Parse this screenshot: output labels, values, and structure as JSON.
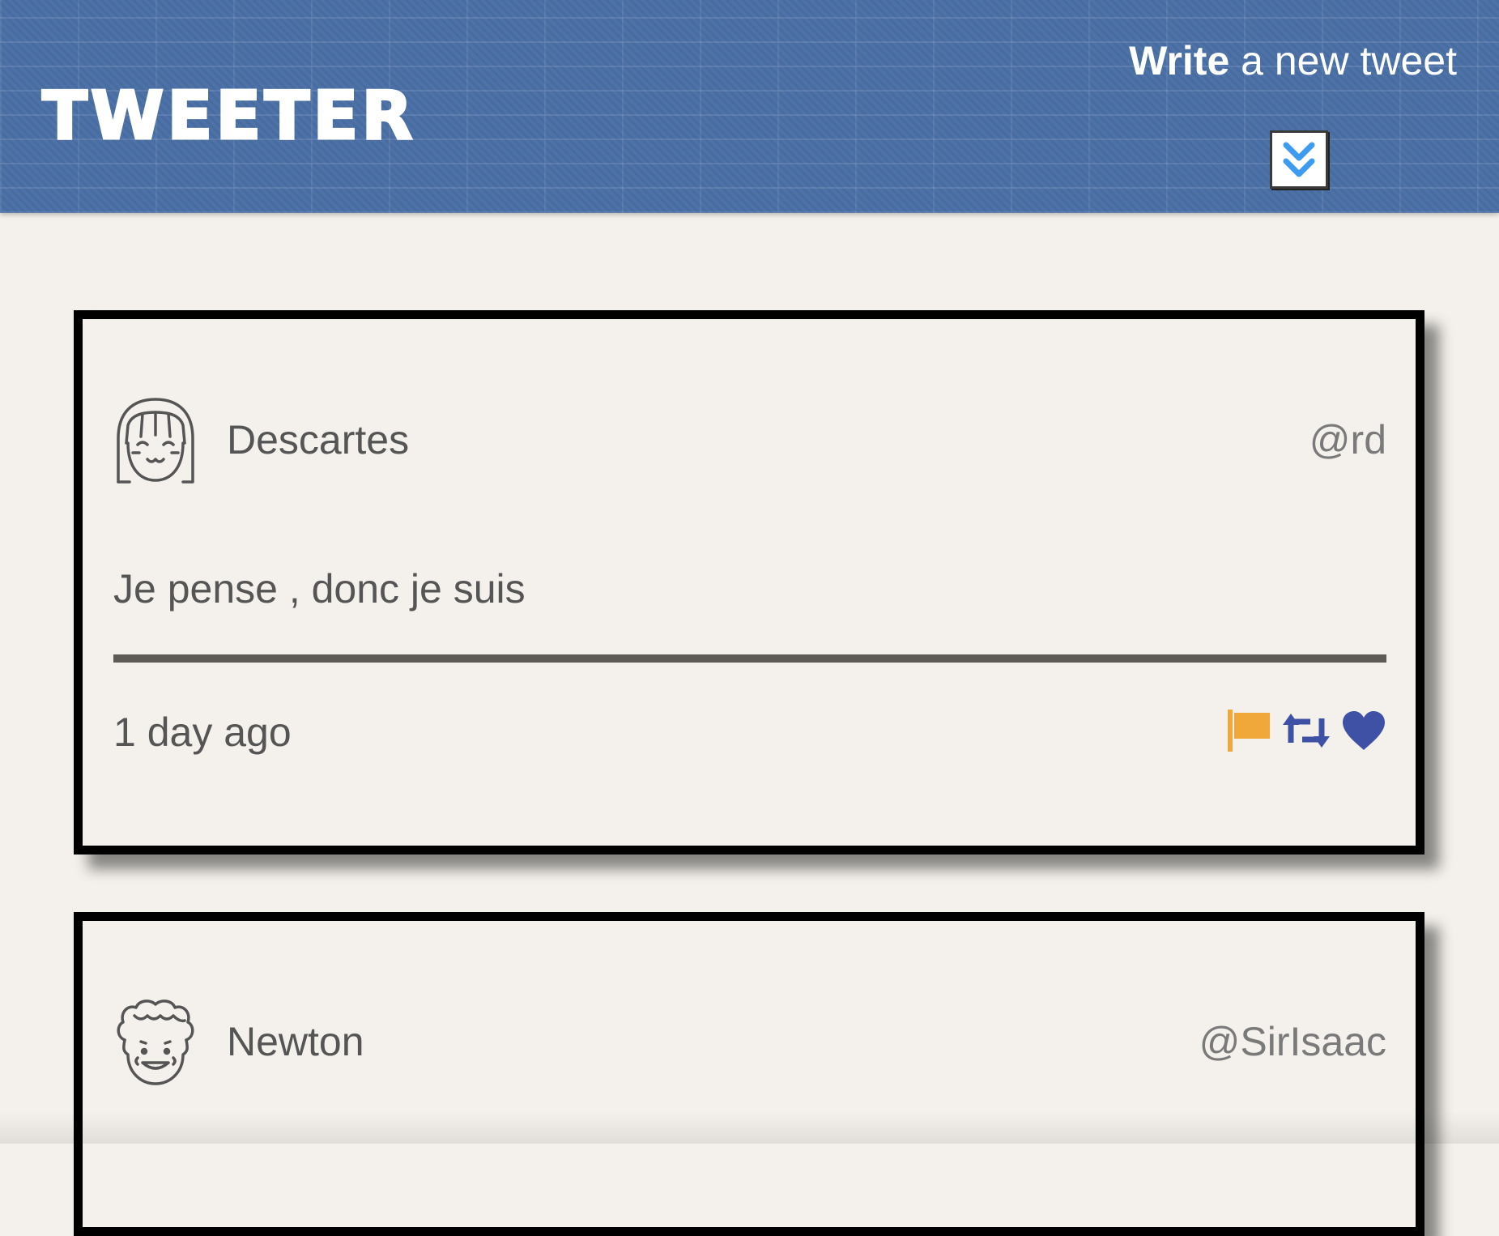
{
  "header": {
    "logo": "TWEETER",
    "compose_bold": "Write",
    "compose_rest": " a new tweet",
    "toggle_icon": "double-chevron-down-icon",
    "brand_color": "#4d72a8"
  },
  "tweets": [
    {
      "name": "Descartes",
      "handle": "@rd",
      "text": "Je pense , donc je suis",
      "time": "1 day ago",
      "avatar_icon": "bangs-girl-avatar-icon",
      "actions": [
        {
          "icon": "flag-icon",
          "color": "#f0a83a"
        },
        {
          "icon": "retweet-icon",
          "color": "#3f51a5"
        },
        {
          "icon": "heart-icon",
          "color": "#3f51a5"
        }
      ]
    },
    {
      "name": "Newton",
      "handle": "@SirIsaac",
      "avatar_icon": "curly-hair-avatar-icon"
    }
  ]
}
